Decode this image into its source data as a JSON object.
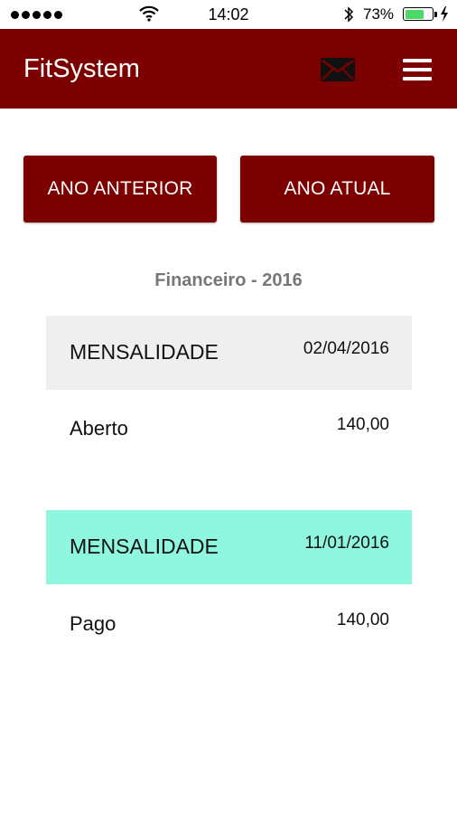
{
  "status_bar": {
    "time": "14:02",
    "battery_percent": "73%",
    "battery_level": 0.73,
    "battery_color": "#4cd964"
  },
  "header": {
    "title": "FitSystem",
    "background": "#7d0000",
    "mail_icon": "mail-icon",
    "menu_icon": "hamburger-menu-icon"
  },
  "buttons": {
    "previous_year": "ANO ANTERIOR",
    "current_year": "ANO ATUAL"
  },
  "section": {
    "title": "Financeiro - 2016"
  },
  "entries": [
    {
      "type": "MENSALIDADE",
      "date": "02/04/2016",
      "status": "Aberto",
      "amount": "140,00",
      "header_color": "#efefef"
    },
    {
      "type": "MENSALIDADE",
      "date": "11/01/2016",
      "status": "Pago",
      "amount": "140,00",
      "header_color": "#8ff7df"
    }
  ]
}
